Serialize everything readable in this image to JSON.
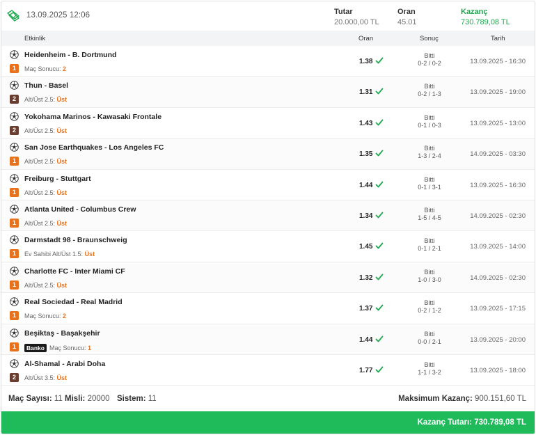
{
  "header": {
    "date": "13.09.2025 12:06",
    "stake_label": "Tutar",
    "stake_value": "20.000,00 TL",
    "odds_label": "Oran",
    "odds_value": "45.01",
    "win_label": "Kazanç",
    "win_value": "730.789,08 TL"
  },
  "columns": {
    "event": "Etkinlik",
    "odds": "Oran",
    "result": "Sonuç",
    "date": "Tarih"
  },
  "rows": [
    {
      "match": "Heidenheim - B. Dortmund",
      "mbs": "1",
      "mbs_color": "#e8721c",
      "banko": "",
      "market": "Maç Sonucu:",
      "pick": "2",
      "odd": "1.38",
      "status": "Bitti",
      "score": "0-2 / 0-2",
      "date": "13.09.2025 - 16:30"
    },
    {
      "match": "Thun - Basel",
      "mbs": "2",
      "mbs_color": "#6b3d2e",
      "banko": "",
      "market": "Alt/Üst 2.5:",
      "pick": "Üst",
      "odd": "1.31",
      "status": "Bitti",
      "score": "0-2 / 1-3",
      "date": "13.09.2025 - 19:00"
    },
    {
      "match": "Yokohama Marinos - Kawasaki Frontale",
      "mbs": "2",
      "mbs_color": "#6b3d2e",
      "banko": "",
      "market": "Alt/Üst 2.5:",
      "pick": "Üst",
      "odd": "1.43",
      "status": "Bitti",
      "score": "0-1 / 0-3",
      "date": "13.09.2025 - 13:00"
    },
    {
      "match": "San Jose Earthquakes - Los Angeles FC",
      "mbs": "1",
      "mbs_color": "#e8721c",
      "banko": "",
      "market": "Alt/Üst 2.5:",
      "pick": "Üst",
      "odd": "1.35",
      "status": "Bitti",
      "score": "1-3 / 2-4",
      "date": "14.09.2025 - 03:30"
    },
    {
      "match": "Freiburg - Stuttgart",
      "mbs": "1",
      "mbs_color": "#e8721c",
      "banko": "",
      "market": "Alt/Üst 2.5:",
      "pick": "Üst",
      "odd": "1.44",
      "status": "Bitti",
      "score": "0-1 / 3-1",
      "date": "13.09.2025 - 16:30"
    },
    {
      "match": "Atlanta United - Columbus Crew",
      "mbs": "1",
      "mbs_color": "#e8721c",
      "banko": "",
      "market": "Alt/Üst 2.5:",
      "pick": "Üst",
      "odd": "1.34",
      "status": "Bitti",
      "score": "1-5 / 4-5",
      "date": "14.09.2025 - 02:30"
    },
    {
      "match": "Darmstadt 98 - Braunschweig",
      "mbs": "1",
      "mbs_color": "#e8721c",
      "banko": "",
      "market": "Ev Sahibi Alt/Üst 1.5:",
      "pick": "Üst",
      "odd": "1.45",
      "status": "Bitti",
      "score": "0-1 / 2-1",
      "date": "13.09.2025 - 14:00"
    },
    {
      "match": "Charlotte FC - Inter Miami CF",
      "mbs": "1",
      "mbs_color": "#e8721c",
      "banko": "",
      "market": "Alt/Üst 2.5:",
      "pick": "Üst",
      "odd": "1.32",
      "status": "Bitti",
      "score": "1-0 / 3-0",
      "date": "14.09.2025 - 02:30"
    },
    {
      "match": "Real Sociedad - Real Madrid",
      "mbs": "1",
      "mbs_color": "#e8721c",
      "banko": "",
      "market": "Maç Sonucu:",
      "pick": "2",
      "odd": "1.37",
      "status": "Bitti",
      "score": "0-2 / 1-2",
      "date": "13.09.2025 - 17:15"
    },
    {
      "match": "Beşiktaş - Başakşehir",
      "mbs": "1",
      "mbs_color": "#e8721c",
      "banko": "Banko",
      "market": "Maç Sonucu:",
      "pick": "1",
      "odd": "1.44",
      "status": "Bitti",
      "score": "0-0 / 2-1",
      "date": "13.09.2025 - 20:00"
    },
    {
      "match": "Al-Shamal - Arabi Doha",
      "mbs": "2",
      "mbs_color": "#6b3d2e",
      "banko": "",
      "market": "Alt/Üst 3.5:",
      "pick": "Üst",
      "odd": "1.77",
      "status": "Bitti",
      "score": "1-1 / 3-2",
      "date": "13.09.2025 - 18:00"
    }
  ],
  "summary": {
    "match_count_label": "Maç Sayısı:",
    "match_count": "11",
    "multiplier_label": "Misli:",
    "multiplier": "20000",
    "system_label": "Sistem:",
    "system": "11",
    "max_win_label": "Maksimum Kazanç:",
    "max_win": "900.151,60 TL"
  },
  "total": {
    "text": "Kazanç Tutarı: 730.789,08 TL"
  },
  "colors": {
    "win_green": "#1fa84f",
    "total_bar": "#1fba5a",
    "pick_orange": "#e8721c",
    "mbs_brown": "#6b3d2e"
  },
  "icons": {
    "ticket": "ticket-check-icon",
    "ball": "soccer-ball-icon",
    "check": "checkmark-icon"
  }
}
